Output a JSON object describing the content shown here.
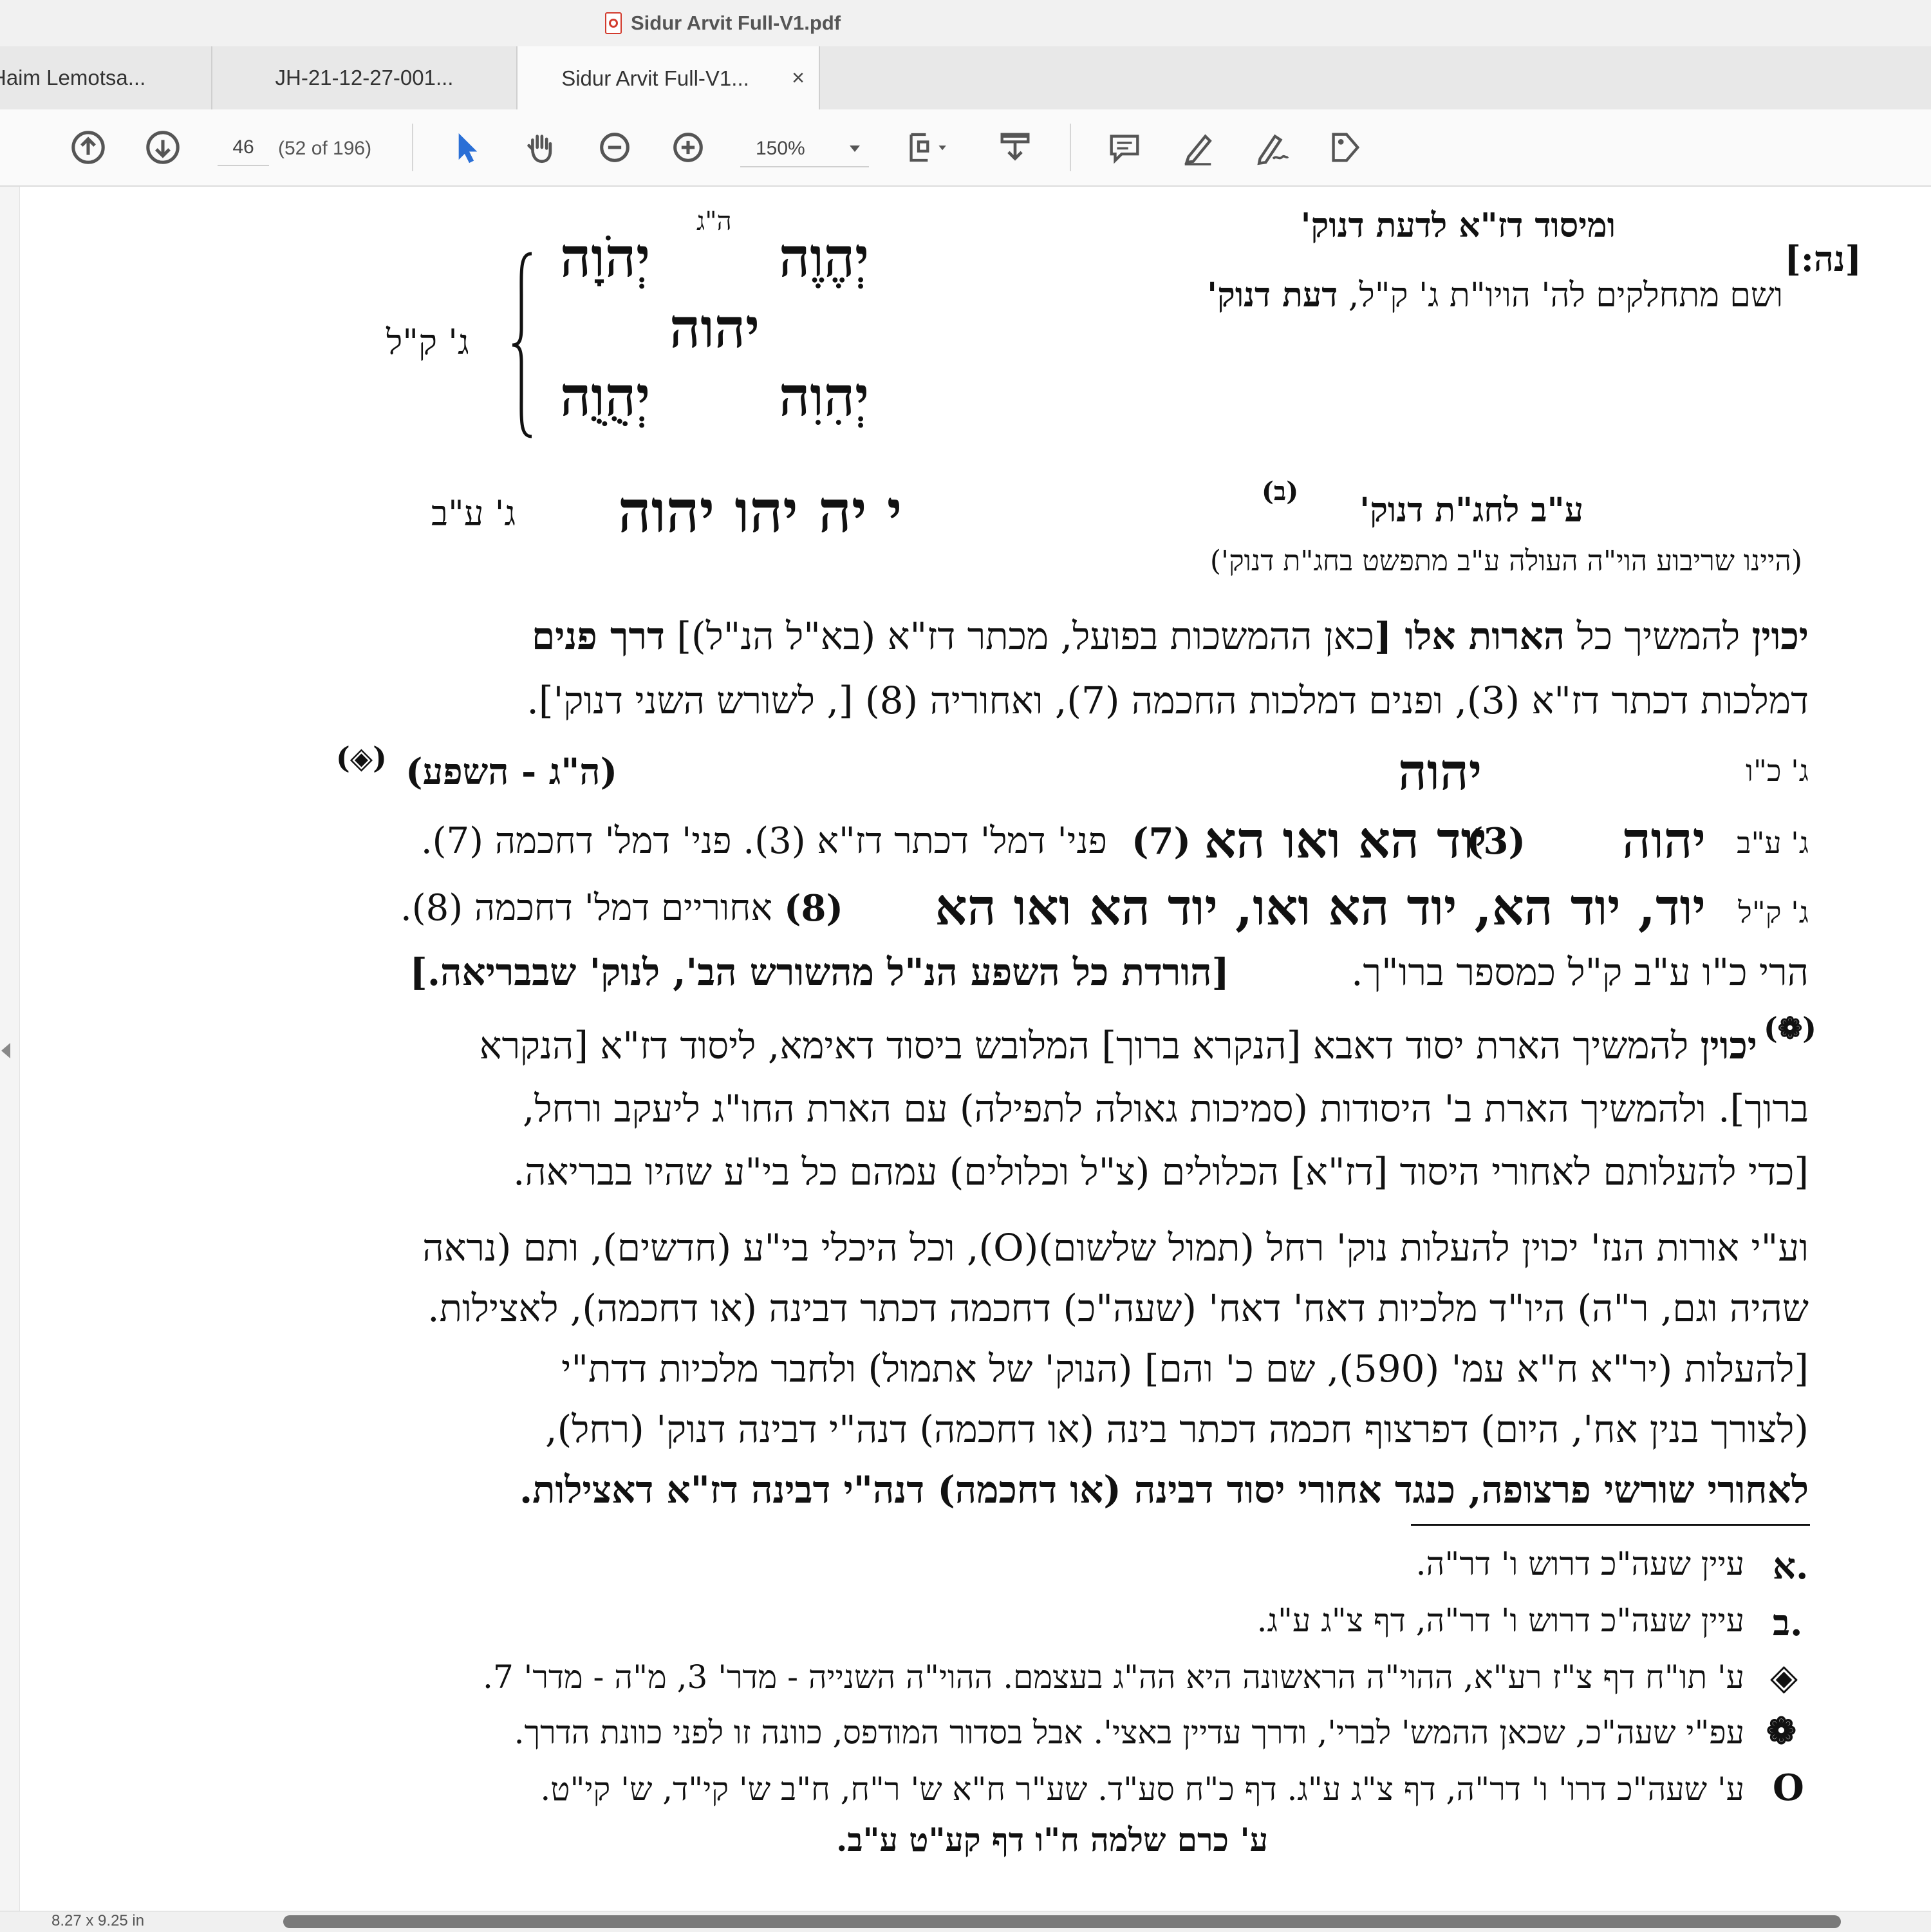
{
  "window": {
    "title": "Sidur Arvit Full-V1.pdf"
  },
  "tabs": [
    {
      "label": "Haim Lemotsa..."
    },
    {
      "label": "JH-21-12-27-001..."
    },
    {
      "label": "Sidur Arvit Full-V1...",
      "close": "×"
    }
  ],
  "toolbar": {
    "page_number": "46",
    "page_count": "(52 of 196)",
    "zoom": "150%",
    "icons": [
      "arrow-up-circle",
      "arrow-down-circle",
      "select-arrow",
      "hand",
      "zoom-out",
      "zoom-in",
      "fit-page",
      "download",
      "comment",
      "highlight-pen",
      "sign",
      "tag"
    ]
  },
  "document": {
    "page_ref": "[נה:]",
    "header_right_1": "ומיסוד דז\"א לדעת דנוק'",
    "header_right_2a": "ושם מתחלקים לה' הויו\"ת ג' ק\"ל,",
    "header_right_2b": "דעת דנוק'",
    "hg_label": "ה\"ג",
    "gk_label": "ג' ק\"ל",
    "yhvh_top_left": "יְהֹוָה",
    "yhvh_top_right": "יְהֶוֶה",
    "yhvh_mid": "יהוה",
    "yhvh_bot_left": "יְהֻוֻה",
    "yhvh_bot_right": "יְהִוִה",
    "ab_right": "ע\"ב לחג\"ת דנוק'",
    "ab_note_mark": "(ב)",
    "ab_sub": "(היינו שריבוע הוי\"ה העולה ע\"ב מתפשט בחג\"ת דנוק')",
    "ribua": "י יה יהו יהוה",
    "gab_label": "ג' ע\"ב",
    "p1_l1a": "יכוין",
    "p1_l1b": "להמשיך כל",
    "p1_l1c": "הארות אלו [",
    "p1_l1d": "כאן ההמשכות בפועל, מכתר דז\"א",
    "p1_l1e": "(בא\"ל הנ\"ל)]",
    "p1_l1f": "דרך פנים",
    "p1_l2": "דמלכות דכתר דז\"א (3), ופנים דמלכות החכמה (7), ואחוריה (8) [, לשורש השני דנוק'].",
    "gkv_label": "ג' כ\"ו",
    "yhvh_center": "יהוה",
    "hg_shefa": "(ה\"ג - השפע)",
    "diamond_mark": "(◈)",
    "line_ab_label": "ג' ע\"ב",
    "line_ab_big": "יהוה",
    "line_ab_n3": "(3)",
    "line_ab_big2": "יוד הא ואו הא",
    "line_ab_n7": "(7)",
    "line_ab_text": "פני' דמל' דכתר דז\"א (3). פני' דמל' דחכמה (7).",
    "line_kl_label": "ג' ק\"ל",
    "line_kl_big": "יוד, יוד הא, יוד הא ואו, יוד הא ואו הא",
    "line_kl_n8": "(8)",
    "line_kl_text": "אחוריים דמל' דחכמה (8).",
    "line_hari": "הרי כ\"ו ע\"ב ק\"ל כמספר ברו\"ך.",
    "line_hari_b": "[הורדת כל השפע הנ\"ל מהשורש הב', לנוק' שבבריאה.]",
    "p2_mark": "(❁)",
    "p2_l1a": "יכוין",
    "p2_l1b": "להמשיך הארת יסוד דאבא [הנקרא ברוך] המלובש ביסוד דאימא, ליסוד דז\"א [הנקרא",
    "p2_l2": "ברוך]. ולהמשיך הארת ב' היסודות (סמיכות גאולה לתפילה) עם הארת החו\"ג ליעקב ורחל,",
    "p2_l3": "[כדי להעלותם לאחורי היסוד [דז\"א] הכלולים (צ\"ל וכלולים) עמהם כל בי\"ע שהיו בבריאה.",
    "p3_l1": "וע\"י אורות הנז' יכוין להעלות נוק' רחל (תמול שלשום)(O), וכל היכלי בי\"ע (חדשים), ותם (נראה",
    "p3_l2": "שהיה וגם, ר\"ה) היו\"ד מלכיות דאח' דאח' (שעה\"כ) דחכמה דכתר דבינה (או דחכמה), לאצילות.",
    "p3_l3": "[להעלות (יר\"א ח\"א עמ' (590), שם כ' והם] (הנוק' של אתמול) ולחבר מלכיות דדת\"י",
    "p3_l4": "(לצורך בנין אח', היום) דפרצוף חכמה דכתר בינה (או דחכמה) דנה\"י דבינה דנוק' (רחל),",
    "p3_l5": "לאחורי שורשי פרצופה, כנגד אחורי יסוד דבינה (או דחכמה) דנה\"י דבינה דז\"א דאצילות.",
    "fn_a_mark": "א.",
    "fn_a": "עיין שעה\"כ דרוש ו' דר\"ה.",
    "fn_b_mark": "ב.",
    "fn_b": "עיין שעה\"כ דרוש ו' דר\"ה, דף צ\"ג ע\"ג.",
    "fn_c_mark": "◈",
    "fn_c": "ע' תו\"ח דף צ\"ז רע\"א, ההוי\"ה הראשונה היא הה\"ג בעצמם. ההוי\"ה השנייה - מדר' 3, מ\"ה - מדר' 7.",
    "fn_d_mark": "❁",
    "fn_d": "עפ\"י שעה\"כ, שכאן ההמש' לברי', ודרך עדיין באצי'. אבל בסדור המודפס, כוונה זו לפני כוונת הדרך.",
    "fn_e_mark": "O",
    "fn_e": "ע' שעה\"כ דרו' ו' דר\"ה, דף צ\"ג ע\"ג. דף כ\"ח סע\"ד. שע\"ר ח\"א ש' ר\"ח, ח\"ב ש' קי\"ד, ש' קי\"ט.",
    "fn_e2": "ע' כרם שלמה ח\"ו דף קע\"ט ע\"ב."
  },
  "status": {
    "page_size": "8.27 x 9.25 in"
  }
}
